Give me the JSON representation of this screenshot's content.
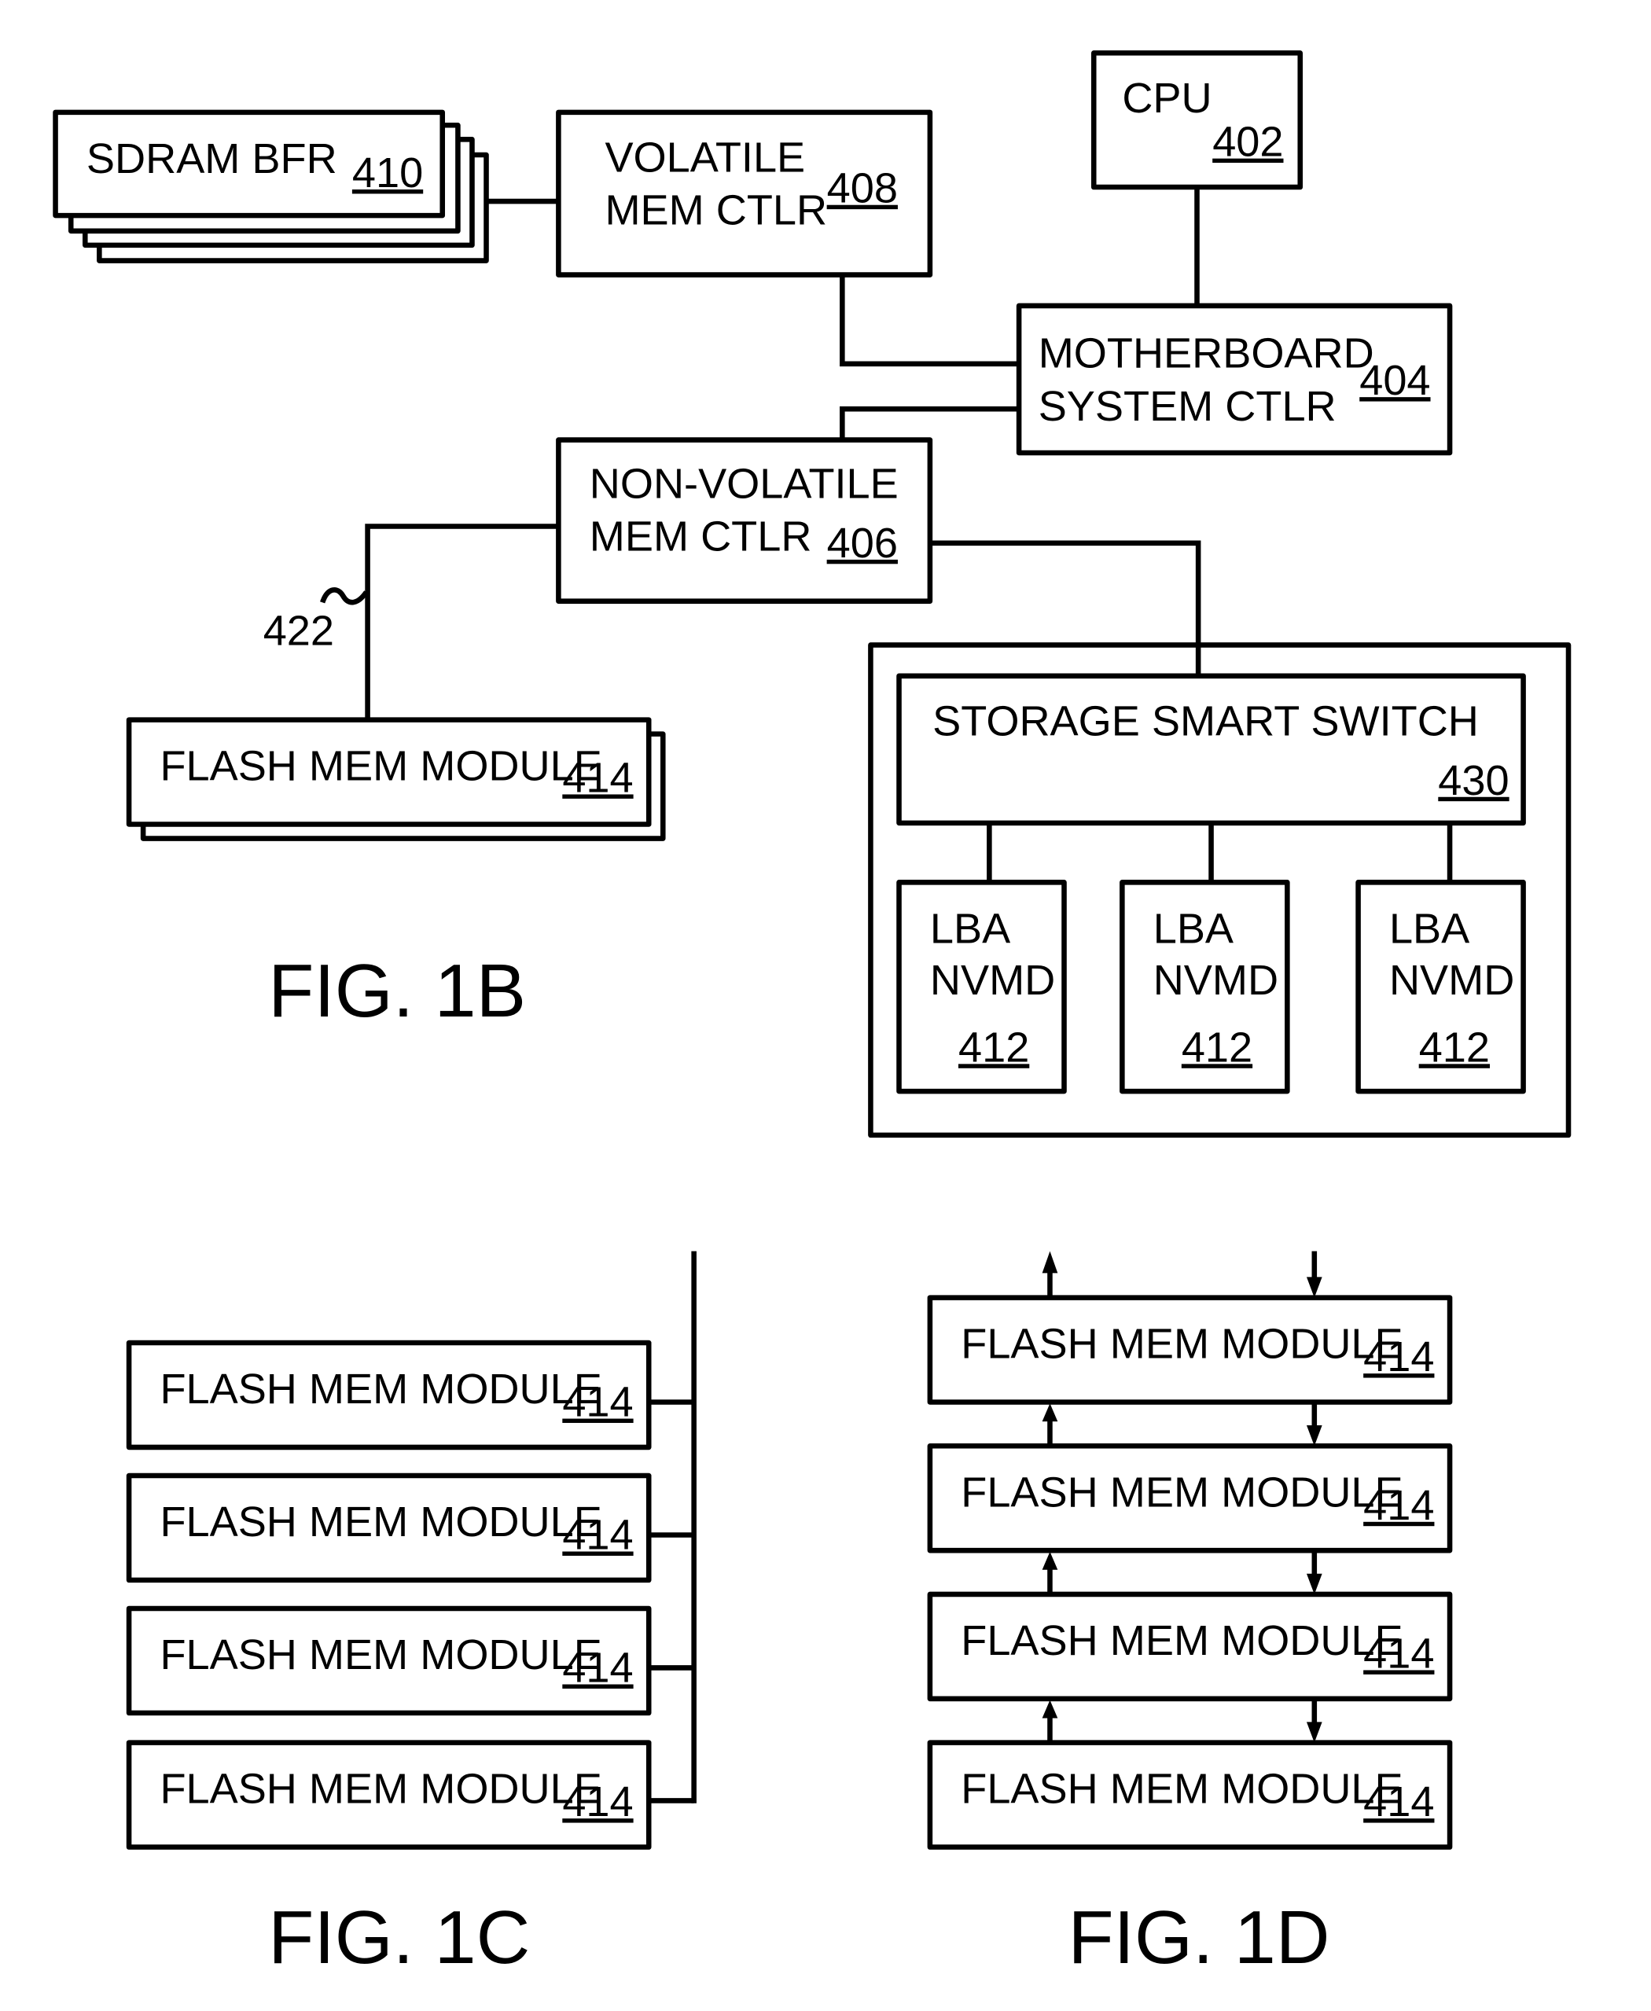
{
  "figures": {
    "fig1b": {
      "caption": "FIG. 1B",
      "cpu": {
        "label": "CPU",
        "ref": "402"
      },
      "motherboard": {
        "line1": "MOTHERBOARD",
        "line2": "SYSTEM CTLR",
        "ref": "404"
      },
      "volatile_ctlr": {
        "line1": "VOLATILE",
        "line2": "MEM CTLR",
        "ref": "408"
      },
      "sdram": {
        "label": "SDRAM  BFR",
        "ref": "410"
      },
      "nonvolatile_ctlr": {
        "line1": "NON-VOLATILE",
        "line2": "MEM CTLR",
        "ref": "406"
      },
      "bus_ref": "422",
      "flash_module": {
        "label": "FLASH MEM MODULE",
        "ref": "414"
      },
      "smart_switch": {
        "label": "STORAGE SMART SWITCH",
        "ref": "430"
      },
      "nvmd": [
        {
          "line1": "LBA",
          "line2": "NVMD",
          "ref": "412"
        },
        {
          "line1": "LBA",
          "line2": "NVMD",
          "ref": "412"
        },
        {
          "line1": "LBA",
          "line2": "NVMD",
          "ref": "412"
        }
      ]
    },
    "fig1c": {
      "caption": "FIG. 1C",
      "modules": [
        {
          "label": "FLASH MEM MODULE",
          "ref": "414"
        },
        {
          "label": "FLASH MEM MODULE",
          "ref": "414"
        },
        {
          "label": "FLASH MEM MODULE",
          "ref": "414"
        },
        {
          "label": "FLASH MEM MODULE",
          "ref": "414"
        }
      ]
    },
    "fig1d": {
      "caption": "FIG. 1D",
      "modules": [
        {
          "label": "FLASH MEM MODULE",
          "ref": "414"
        },
        {
          "label": "FLASH MEM MODULE",
          "ref": "414"
        },
        {
          "label": "FLASH MEM MODULE",
          "ref": "414"
        },
        {
          "label": "FLASH MEM MODULE",
          "ref": "414"
        }
      ]
    }
  }
}
